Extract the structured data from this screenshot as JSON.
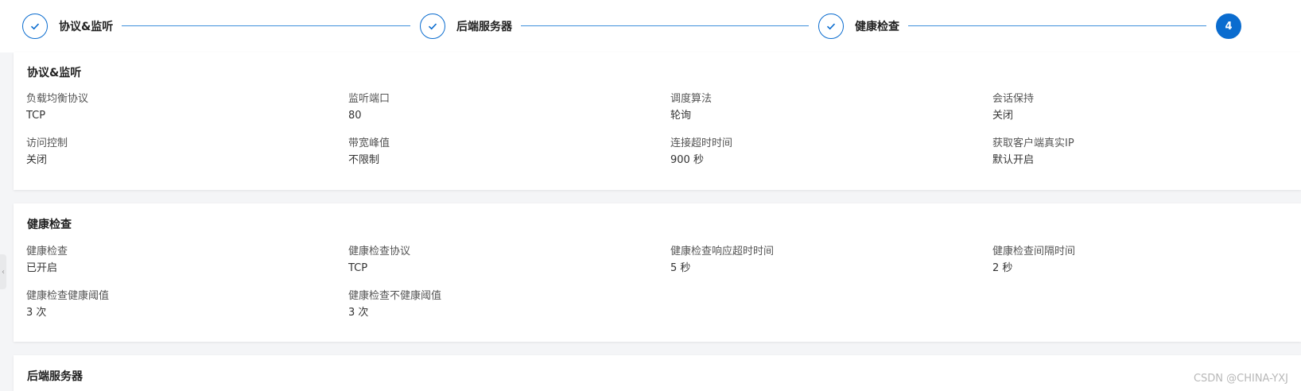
{
  "steps": [
    {
      "label": "协议&监听",
      "status": "done"
    },
    {
      "label": "后端服务器",
      "status": "done"
    },
    {
      "label": "健康检查",
      "status": "done"
    },
    {
      "number": "4",
      "status": "active"
    }
  ],
  "listener_card": {
    "title": "协议&监听",
    "fields": [
      {
        "label": "负载均衡协议",
        "value": "TCP"
      },
      {
        "label": "监听端口",
        "value": "80"
      },
      {
        "label": "调度算法",
        "value": "轮询"
      },
      {
        "label": "会话保持",
        "value": "关闭"
      },
      {
        "label": "访问控制",
        "value": "关闭"
      },
      {
        "label": "带宽峰值",
        "value": "不限制"
      },
      {
        "label": "连接超时时间",
        "value": "900 秒"
      },
      {
        "label": "获取客户端真实IP",
        "value": "默认开启"
      }
    ]
  },
  "health_card": {
    "title": "健康检查",
    "fields": [
      {
        "label": "健康检查",
        "value": "已开启"
      },
      {
        "label": "健康检查协议",
        "value": "TCP"
      },
      {
        "label": "健康检查响应超时时间",
        "value": "5 秒"
      },
      {
        "label": "健康检查间隔时间",
        "value": "2 秒"
      },
      {
        "label": "健康检查健康阈值",
        "value": "3 次"
      },
      {
        "label": "健康检查不健康阈值",
        "value": "3 次"
      }
    ]
  },
  "backend_card": {
    "title": "后端服务器"
  },
  "side_handle_icon": "chevron-left-icon",
  "watermark": "CSDN @CHINA-YXJ",
  "colors": {
    "accent": "#0a6ccf",
    "line": "#3d8fdc"
  }
}
